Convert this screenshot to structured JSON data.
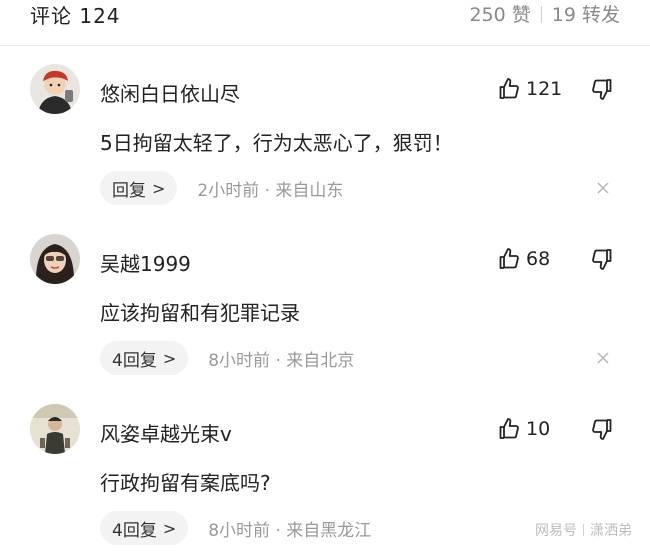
{
  "header": {
    "title": "评论 124",
    "likes": "250 赞",
    "shares": "19 转发"
  },
  "comments": [
    {
      "username": "悠闲白日依山尽",
      "like_count": "121",
      "text": "5日拘留太轻了，行为太恶心了，狠罚！",
      "reply_label": "回复",
      "meta": "2小时前 · 来自山东"
    },
    {
      "username": "吴越1999",
      "like_count": "68",
      "text": "应该拘留和有犯罪记录",
      "reply_label": "4回复",
      "meta": "8小时前 · 来自北京"
    },
    {
      "username": "风姿卓越光束v",
      "like_count": "10",
      "text": "行政拘留有案底吗?",
      "reply_label": "4回复",
      "meta": "8小时前 · 来自黑龙江"
    }
  ],
  "watermark": {
    "left": "网易号",
    "right": "潇洒弟"
  }
}
